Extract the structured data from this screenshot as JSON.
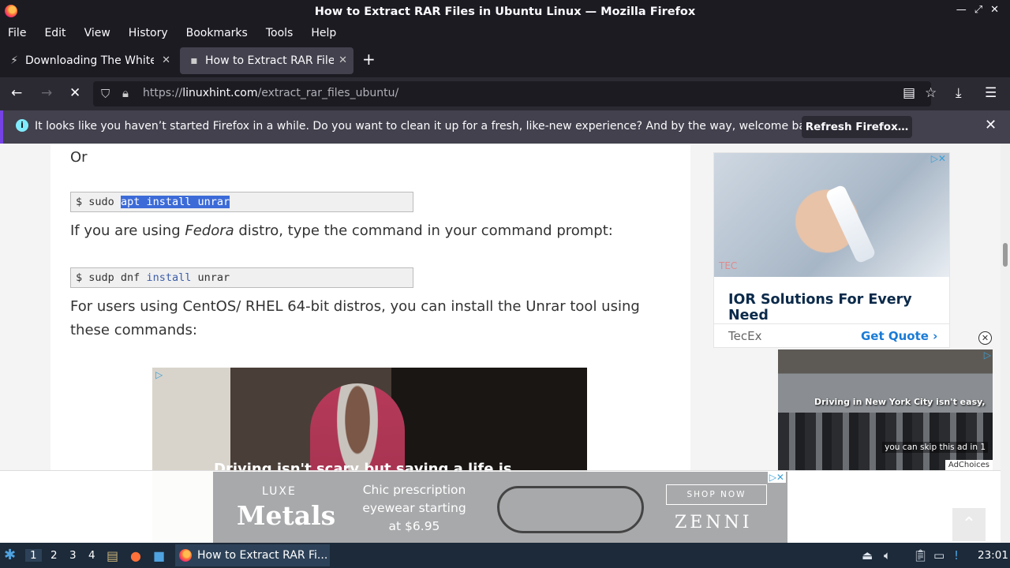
{
  "window": {
    "title": "How to Extract RAR Files in Ubuntu Linux — Mozilla Firefox"
  },
  "menu": [
    "File",
    "Edit",
    "View",
    "History",
    "Bookmarks",
    "Tools",
    "Help"
  ],
  "tabs": [
    {
      "label": "Downloading The White Lotus",
      "favicon": "lightning-icon"
    },
    {
      "label": "How to Extract RAR Files in Ubuntu Linux",
      "favicon": "linuxhint-icon"
    }
  ],
  "url": {
    "prefix": "https://",
    "host": "linuxhint.com",
    "path": "/extract_rar_files_ubuntu/"
  },
  "notification": {
    "message": "It looks like you haven’t started Firefox in a while. Do you want to clean it up for a fresh, like-new experience? And by the way, welcome back!",
    "button": "Refresh Firefox…"
  },
  "article": {
    "or_text": "Or",
    "code1": {
      "prompt": "$",
      "cmd": "sudo",
      "selected": "apt install unrar"
    },
    "fedora_pre": "If you are using ",
    "fedora_em": "Fedora",
    "fedora_post": " distro, type the command in your command prompt:",
    "code2": {
      "prompt": "$",
      "cmd1": "sudp dnf",
      "kw": "install",
      "cmd2": "unrar"
    },
    "centos_line1": "For users using CentOS/ RHEL 64-bit distros, you can install the Unrar tool using",
    "centos_line2": "these commands:",
    "video_caption": "Driving isn't scary but saving a life is"
  },
  "side_ad": {
    "tag": "TEC",
    "headline": "IOR Solutions For Every Need",
    "brand": "TecEx",
    "cta": "Get Quote ›"
  },
  "float_video": {
    "caption": "Driving in New York City isn't easy,",
    "skip": "you can skip this ad in 1",
    "adchoices": "AdChoices"
  },
  "banner": {
    "luxe": "LUXE",
    "metals": "Metals",
    "offer": "Chic prescription eyewear starting at $6.95",
    "shop": "SHOP NOW",
    "brand": "ZENNI"
  },
  "taskbar": {
    "workspaces": [
      "1",
      "2",
      "3",
      "4"
    ],
    "task": "How to Extract RAR Fi...",
    "clock": "23:01"
  }
}
